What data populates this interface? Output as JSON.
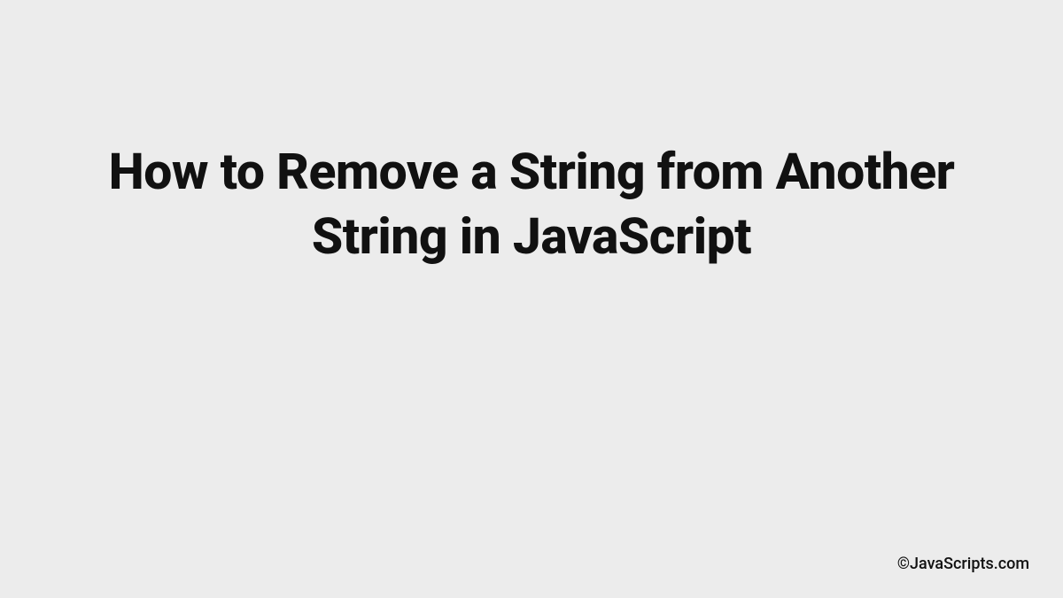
{
  "document": {
    "title": "How to Remove a String from Another String in JavaScript",
    "credit": "©JavaScripts.com"
  }
}
